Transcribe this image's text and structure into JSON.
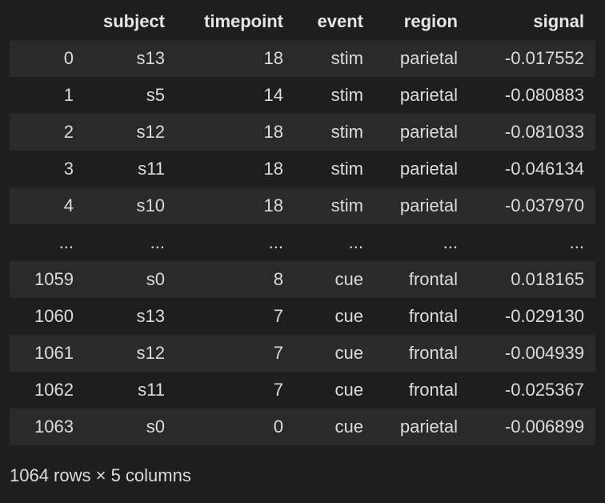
{
  "table": {
    "columns": [
      "",
      "subject",
      "timepoint",
      "event",
      "region",
      "signal"
    ],
    "rows": [
      [
        "0",
        "s13",
        "18",
        "stim",
        "parietal",
        "-0.017552"
      ],
      [
        "1",
        "s5",
        "14",
        "stim",
        "parietal",
        "-0.080883"
      ],
      [
        "2",
        "s12",
        "18",
        "stim",
        "parietal",
        "-0.081033"
      ],
      [
        "3",
        "s11",
        "18",
        "stim",
        "parietal",
        "-0.046134"
      ],
      [
        "4",
        "s10",
        "18",
        "stim",
        "parietal",
        "-0.037970"
      ],
      [
        "...",
        "...",
        "...",
        "...",
        "...",
        "..."
      ],
      [
        "1059",
        "s0",
        "8",
        "cue",
        "frontal",
        "0.018165"
      ],
      [
        "1060",
        "s13",
        "7",
        "cue",
        "frontal",
        "-0.029130"
      ],
      [
        "1061",
        "s12",
        "7",
        "cue",
        "frontal",
        "-0.004939"
      ],
      [
        "1062",
        "s11",
        "7",
        "cue",
        "frontal",
        "-0.025367"
      ],
      [
        "1063",
        "s0",
        "0",
        "cue",
        "parietal",
        "-0.006899"
      ]
    ]
  },
  "footer": {
    "summary": "1064 rows × 5 columns"
  }
}
